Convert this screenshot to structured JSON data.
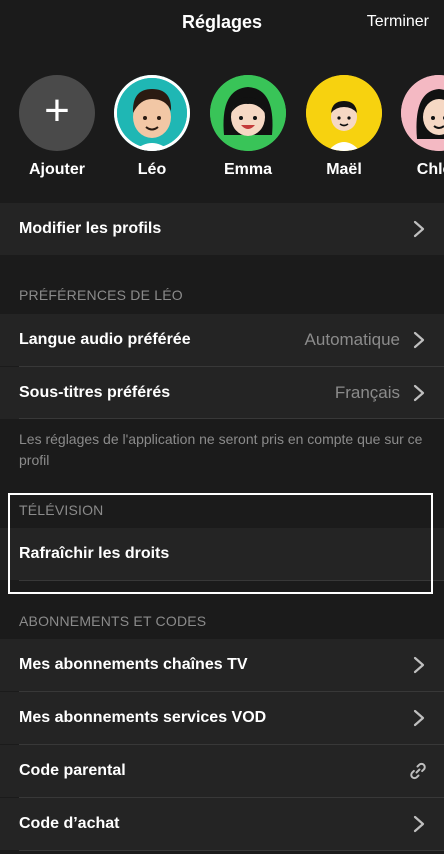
{
  "header": {
    "title": "Réglages",
    "done_label": "Terminer"
  },
  "profiles": [
    {
      "name": "Ajouter",
      "type": "add",
      "bg": "#4a4a4a"
    },
    {
      "name": "Léo",
      "type": "avatar",
      "bg": "#1fb7b4"
    },
    {
      "name": "Emma",
      "type": "avatar",
      "bg": "#39c458"
    },
    {
      "name": "Maël",
      "type": "avatar",
      "bg": "#f7d20f"
    },
    {
      "name": "Chloé",
      "type": "avatar",
      "bg": "#f4b9c3"
    }
  ],
  "edit_profiles": {
    "label": "Modifier les profils"
  },
  "preferences": {
    "title": "PRÉFÉRENCES DE LÉO",
    "audio": {
      "label": "Langue audio préférée",
      "value": "Automatique"
    },
    "subtitles": {
      "label": "Sous-titres préférés",
      "value": "Français"
    },
    "note": "Les réglages de l'application ne seront pris en compte que sur ce profil"
  },
  "television": {
    "title": "TÉLÉVISION",
    "refresh_label": "Rafraîchir les droits"
  },
  "subscriptions": {
    "title": "ABONNEMENTS ET CODES",
    "tv_channels": "Mes abonnements chaînes TV",
    "vod": "Mes abonnements services VOD",
    "parental": "Code parental",
    "purchase": "Code d’achat"
  }
}
